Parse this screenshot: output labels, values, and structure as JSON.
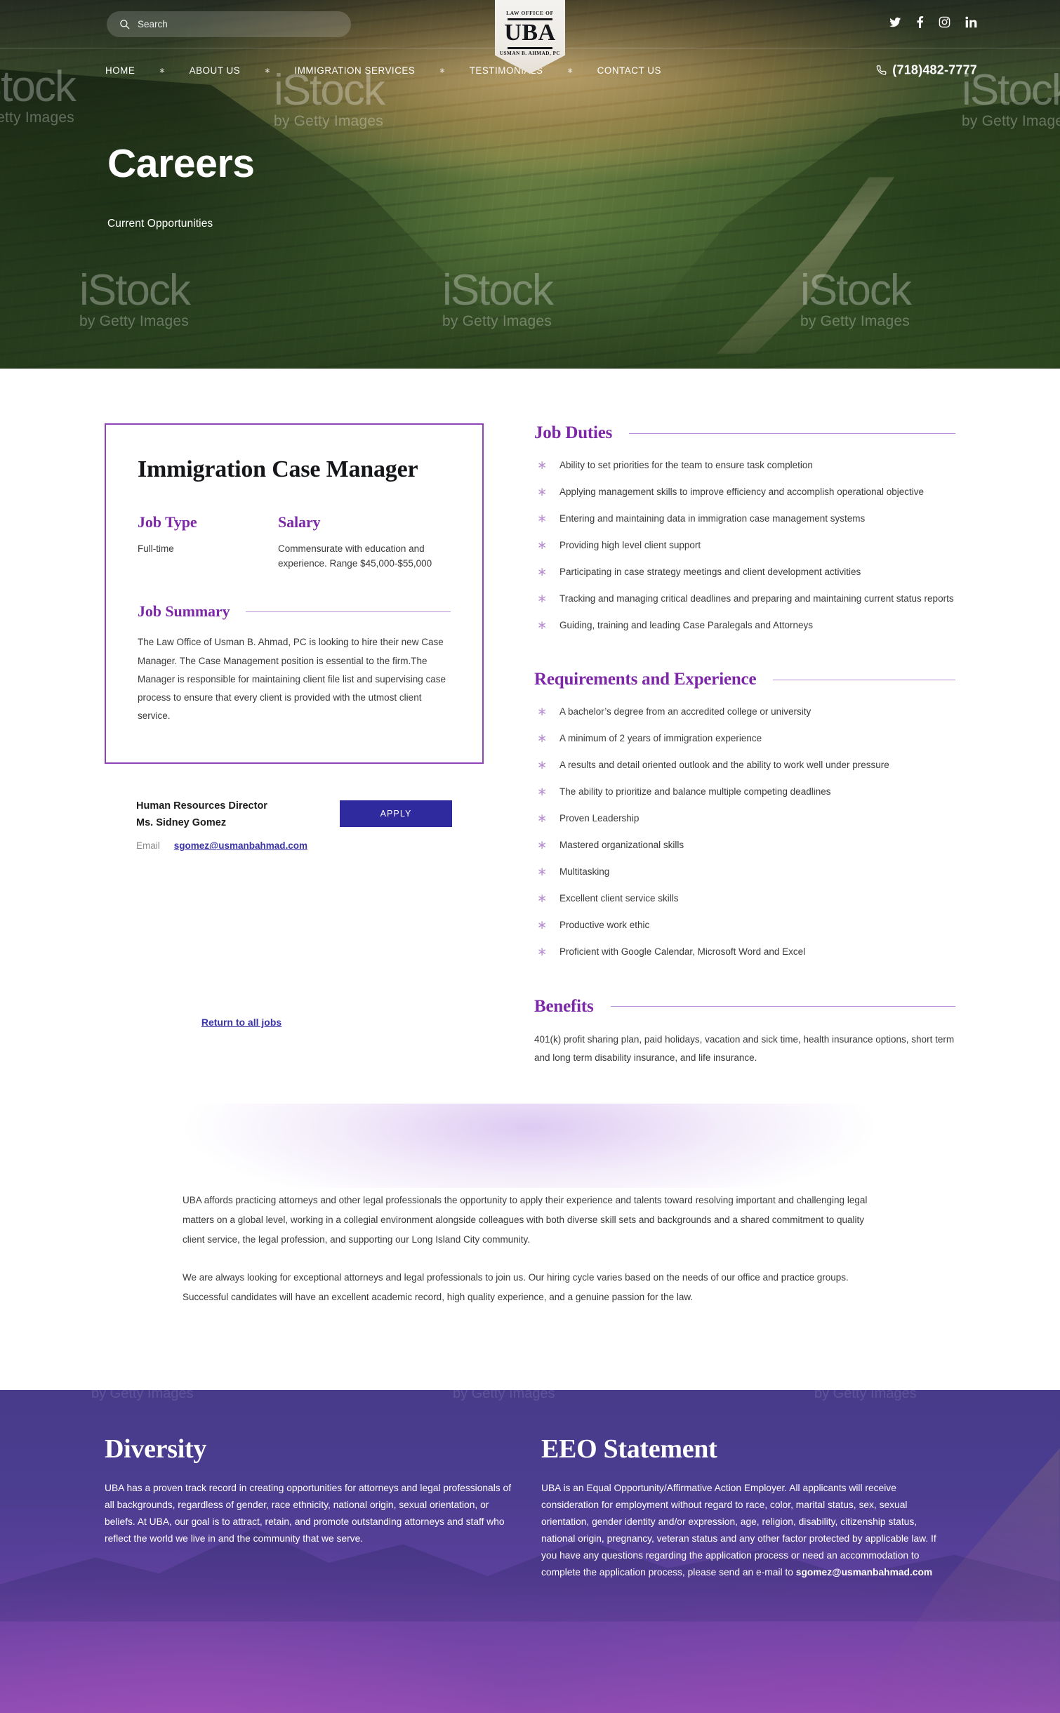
{
  "topbar": {
    "search": {
      "placeholder": "Search",
      "value": "",
      "icon": "search-icon"
    },
    "socials": [
      {
        "name": "twitter-icon",
        "label": "Twitter"
      },
      {
        "name": "facebook-icon",
        "label": "Facebook"
      },
      {
        "name": "instagram-icon",
        "label": "Instagram"
      },
      {
        "name": "linkedin-icon",
        "label": "LinkedIn"
      }
    ]
  },
  "logo": {
    "line1": "LAW OFFICE OF",
    "line2": "UBA",
    "line3": "USMAN B. AHMAD, PC"
  },
  "nav": {
    "items": [
      {
        "label": "HOME"
      },
      {
        "label": "ABOUT US"
      },
      {
        "label": "IMMIGRATION SERVICES"
      },
      {
        "label": "TESTIMONIALS"
      },
      {
        "label": "CONTACT US"
      }
    ],
    "separator": "∗",
    "phone": "(718)482-7777",
    "phone_icon": "phone-icon"
  },
  "hero": {
    "title": "Careers",
    "subtitle": "Current Opportunities",
    "watermark_big": "iStock",
    "watermark_small": "by Getty Images"
  },
  "job": {
    "title": "Immigration Case Manager",
    "job_type_label": "Job Type",
    "job_type_value": "Full-time",
    "salary_label": "Salary",
    "salary_value": "Commensurate with education and experience. Range $45,000-$55,000",
    "summary_label": "Job Summary",
    "summary_text": "The Law Office of Usman B. Ahmad, PC is looking to hire their new Case Manager. The Case Management position is essential to the firm.The Manager is responsible for maintaining client file list and supervising case process to ensure that every client is provided with the utmost client service."
  },
  "contact": {
    "role": "Human Resources Director",
    "person": "Ms. Sidney Gomez",
    "email_label": "Email",
    "email": "sgomez@usmanbahmad.com",
    "apply_label": "APPLY"
  },
  "return_link": "Return to all jobs",
  "duties": {
    "title": "Job Duties",
    "items": [
      "Ability to set priorities for the team to ensure task completion",
      "Applying management skills to improve efficiency and accomplish operational objective",
      "Entering and maintaining data in immigration case management systems",
      "Providing high level client support",
      "Participating in case strategy meetings and client development activities",
      "Tracking and managing critical deadlines and preparing and maintaining current status reports",
      "Guiding, training and leading Case Paralegals and Attorneys"
    ]
  },
  "requirements": {
    "title": "Requirements and Experience",
    "items": [
      "A bachelor’s degree from an accredited college or university",
      "A minimum of 2 years of immigration experience",
      "A results and detail oriented outlook and the ability to work well under pressure",
      "The ability to prioritize and balance multiple competing deadlines",
      "Proven Leadership",
      "Mastered organizational skills",
      "Multitasking",
      "Excellent client service skills",
      "Productive work ethic",
      "Proficient with Google Calendar, Microsoft Word and Excel"
    ]
  },
  "benefits": {
    "title": "Benefits",
    "text": "401(k) profit sharing plan, paid holidays, vacation and sick time, health insurance options, short term and long term disability insurance, and life insurance."
  },
  "intro": {
    "paragraph1": "UBA affords practicing attorneys and other legal professionals the opportunity to apply their experience and talents toward resolving important and challenging legal matters on a global level, working in a collegial environment alongside colleagues with both diverse skill sets and backgrounds and a shared commitment to quality client service, the legal profession, and supporting our Long Island City community.",
    "paragraph2": "We are always looking for exceptional attorneys and legal professionals to join us. Our hiring cycle varies based on the needs of our office and practice groups. Successful candidates will have an excellent academic record, high quality experience, and a genuine passion for the law."
  },
  "footer": {
    "diversity_title": "Diversity",
    "diversity_text": "UBA has a proven track record in creating opportunities for attorneys and legal professionals of all backgrounds, regardless of gender, race ethnicity, national origin, sexual orientation, or beliefs. At UBA, our goal is to attract, retain, and promote outstanding attorneys and staff who reflect the world we live in and the community that we serve.",
    "eeo_title": "EEO Statement",
    "eeo_text": "UBA is an Equal Opportunity/Affirmative Action Employer. All applicants will receive consideration for employment without regard to race, color, marital status, sex, sexual orientation, gender identity and/or expression, age, religion, disability, citizenship status, national origin, pregnancy, veteran status and any other factor protected by applicable law. If you have any questions regarding the application process or need an accommodation to complete the application process, please send an e-mail to ",
    "eeo_email": "sgomez@usmanbahmad.com",
    "watermark_small": "by Getty Images"
  },
  "colors": {
    "purple_heading": "#7d28a8",
    "purple_border": "#8e44b8",
    "purple_rule": "#b98fd4",
    "apply_button": "#2f2a9e",
    "link": "#3b34a8"
  }
}
